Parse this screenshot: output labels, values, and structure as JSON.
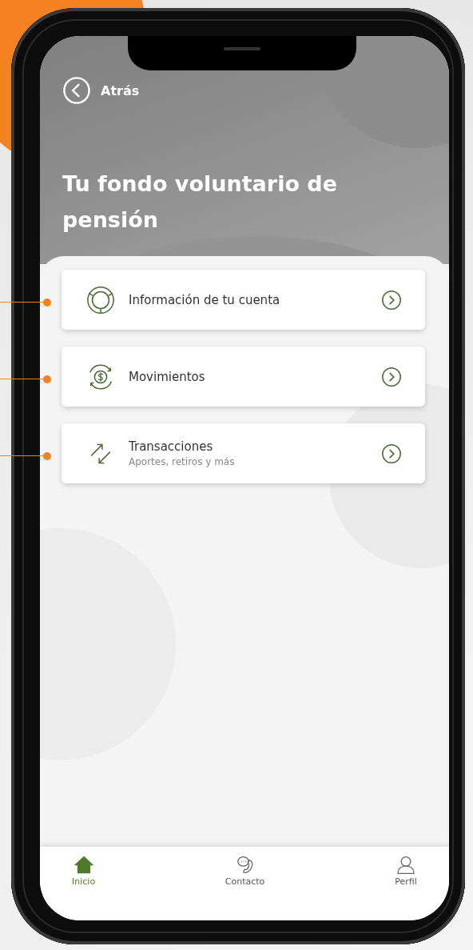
{
  "back": {
    "label": "Atrás"
  },
  "title": "Tu fondo voluntario de pensión",
  "menu": [
    {
      "kind": "account",
      "label": "Información de tu cuenta"
    },
    {
      "kind": "movements",
      "label": "Movimientos"
    },
    {
      "kind": "transactions",
      "label": "Transacciones",
      "subtitle": "Aportes, retiros y más"
    }
  ],
  "nav": [
    {
      "kind": "home",
      "label": "Inicio",
      "selected": true
    },
    {
      "kind": "contact",
      "label": "Contacto",
      "selected": false
    },
    {
      "kind": "profile",
      "label": "Perfil",
      "selected": false
    }
  ]
}
